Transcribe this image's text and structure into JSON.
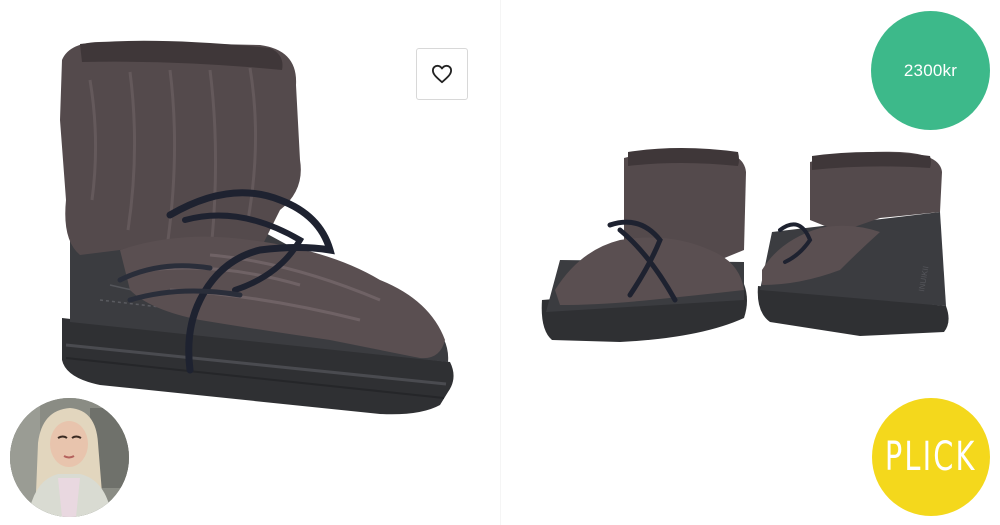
{
  "listing": {
    "price": "2300kr",
    "brand_logo_text": "PLICK"
  },
  "icons": {
    "favorite": "heart-outline-icon"
  },
  "colors": {
    "price_badge": "#3db98a",
    "brand_badge": "#f4d81c",
    "boot_leather": "#3b3c40",
    "boot_fur": "#544a4c",
    "laces": "#1e2230"
  }
}
